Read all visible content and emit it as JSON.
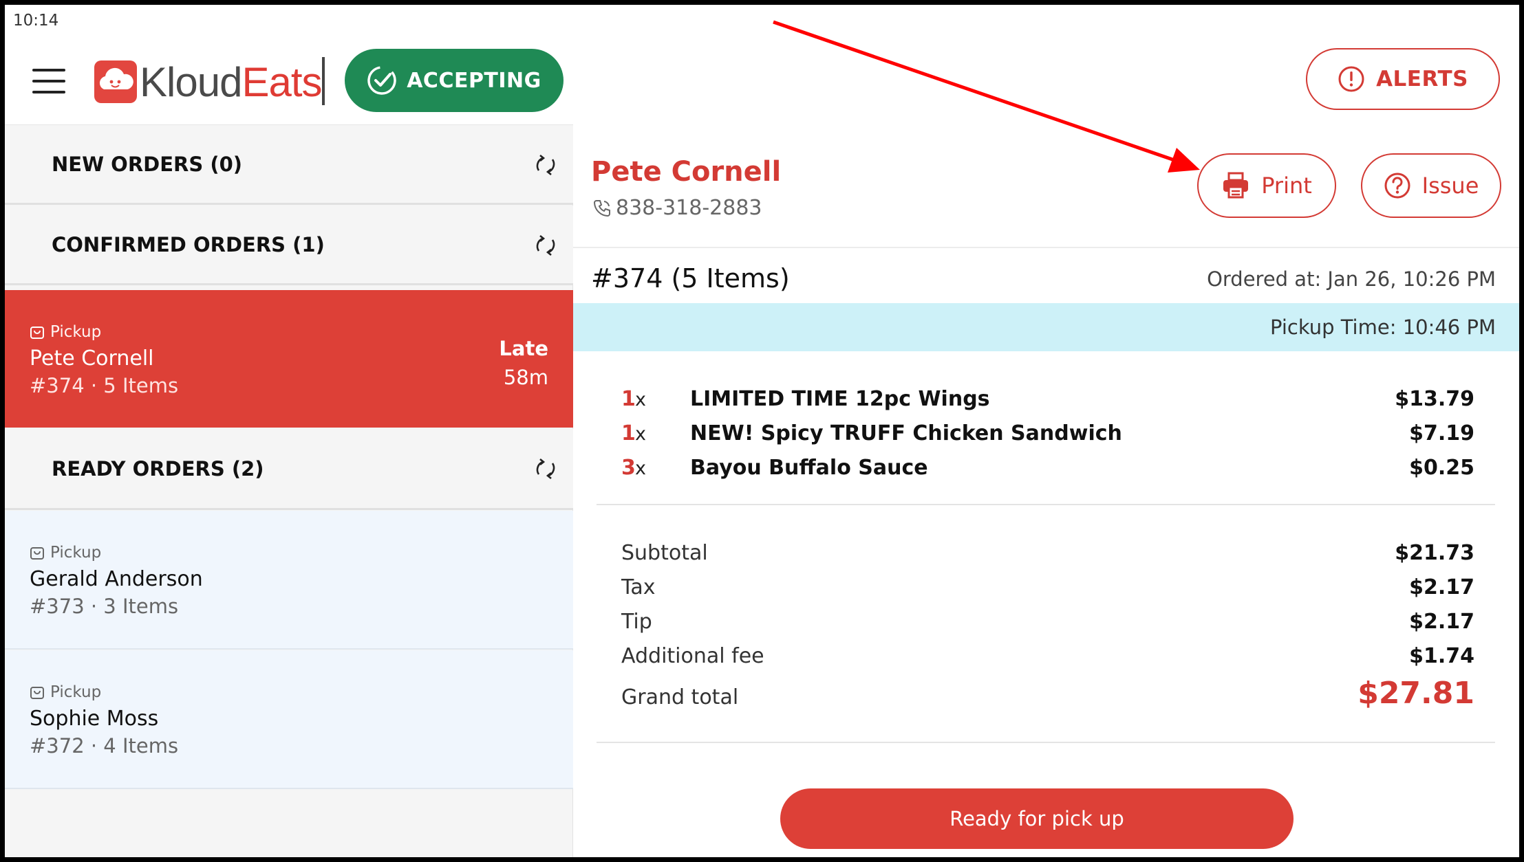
{
  "status_bar": {
    "time": "10:14"
  },
  "header": {
    "logo_part1": "Kloud",
    "logo_part2": "Eats",
    "accepting_label": "ACCEPTING",
    "alerts_label": "ALERTS"
  },
  "sidebar": {
    "new_orders": "NEW ORDERS (0)",
    "confirmed_orders": "CONFIRMED ORDERS (1)",
    "ready_orders": "READY ORDERS (2)",
    "active_order": {
      "type": "Pickup",
      "name": "Pete Cornell",
      "meta": "#374 · 5 Items",
      "late_label": "Late",
      "late_time": "58m"
    },
    "ready_list": [
      {
        "type": "Pickup",
        "name": "Gerald Anderson",
        "meta": "#373 · 3 Items"
      },
      {
        "type": "Pickup",
        "name": "Sophie Moss",
        "meta": "#372 · 4 Items"
      }
    ]
  },
  "detail": {
    "customer_name": "Pete Cornell",
    "customer_phone": "838-318-2883",
    "print_label": "Print",
    "issue_label": "Issue",
    "order_title": "#374 (5 Items)",
    "ordered_at": "Ordered at: Jan 26, 10:26 PM",
    "pickup_time": "Pickup Time: 10:46 PM",
    "items": [
      {
        "qty": "1",
        "x": "x",
        "name": "LIMITED TIME 12pc Wings",
        "price": "$13.79"
      },
      {
        "qty": "1",
        "x": "x",
        "name": "NEW! Spicy TRUFF Chicken Sandwich",
        "price": "$7.19"
      },
      {
        "qty": "3",
        "x": "x",
        "name": "Bayou Buffalo Sauce",
        "price": "$0.25"
      }
    ],
    "summary": {
      "subtotal_label": "Subtotal",
      "subtotal": "$21.73",
      "tax_label": "Tax",
      "tax": "$2.17",
      "tip_label": "Tip",
      "tip": "$2.17",
      "fee_label": "Additional fee",
      "fee": "$1.74",
      "grand_label": "Grand total",
      "grand": "$27.81"
    },
    "ready_button": "Ready for pick up"
  },
  "colors": {
    "brand_red": "#dd4037",
    "accepting_green": "#1f8a55",
    "pickup_bar": "#cdf1f8",
    "annotation_arrow": "#ff0000"
  },
  "icons": [
    "menu-icon",
    "cloud-logo-icon",
    "check-circle-icon",
    "alert-icon",
    "refresh-icon",
    "bag-icon",
    "phone-icon",
    "printer-icon",
    "help-icon"
  ]
}
